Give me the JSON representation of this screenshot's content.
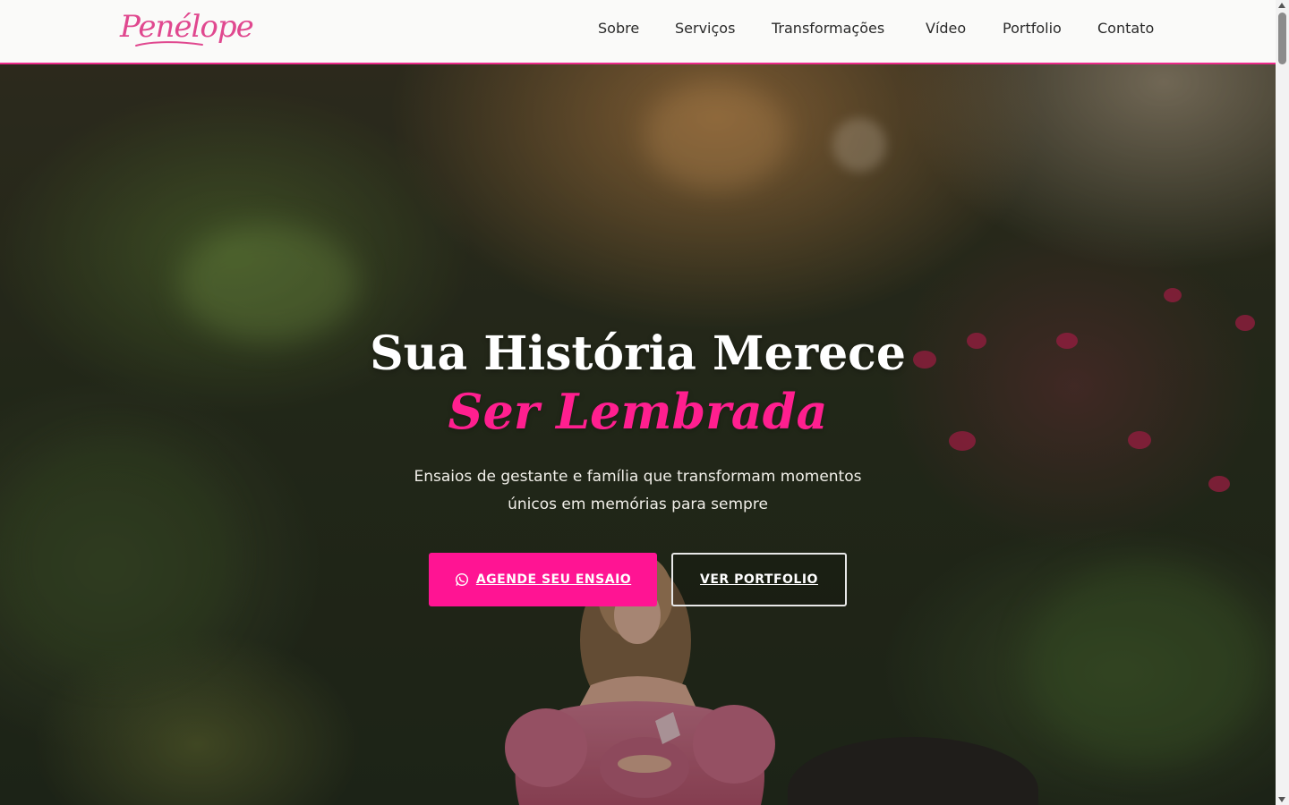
{
  "brand": {
    "logo_text": "Penélope",
    "accent_color": "#ff1493",
    "logo_color": "#e0488f"
  },
  "nav": {
    "items": [
      {
        "label": "Sobre"
      },
      {
        "label": "Serviços"
      },
      {
        "label": "Transformações"
      },
      {
        "label": "Vídeo"
      },
      {
        "label": "Portfolio"
      },
      {
        "label": "Contato"
      }
    ]
  },
  "hero": {
    "title_line1": "Sua História Merece",
    "title_line2": "Ser Lembrada",
    "subtitle": "Ensaios de gestante e família que transformam momentos únicos em memórias para sempre",
    "primary_button": {
      "label": "AGENDE SEU ENSAIO",
      "icon": "whatsapp-icon"
    },
    "secondary_button": {
      "label": "VER PORTFOLIO"
    }
  }
}
